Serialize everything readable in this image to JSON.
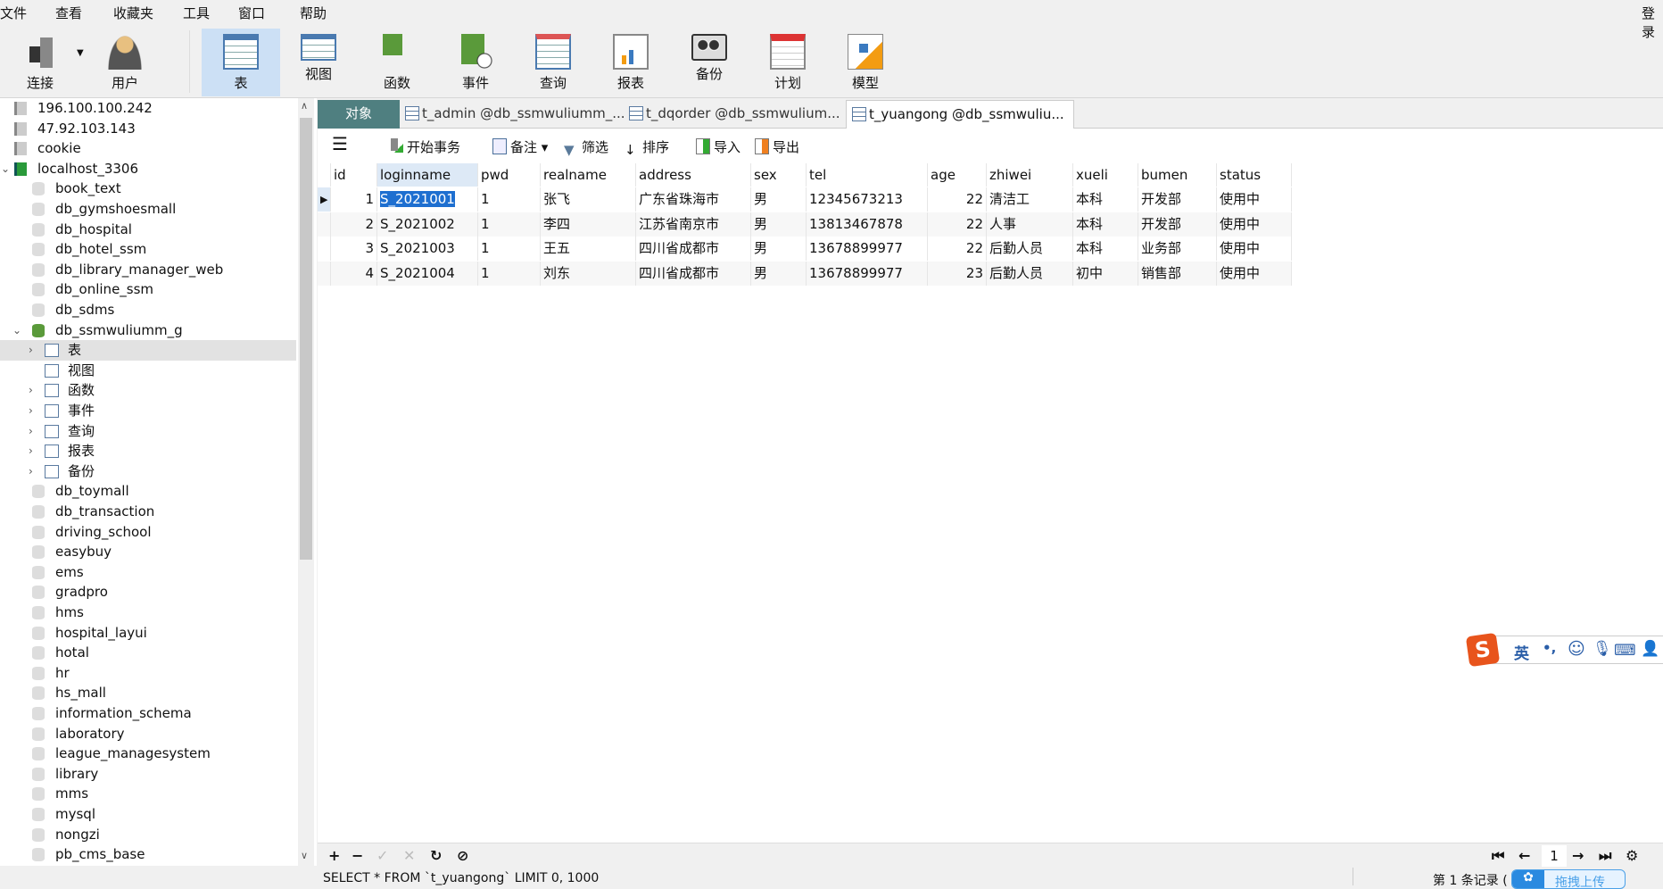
{
  "menubar": {
    "items": [
      "文件",
      "查看",
      "收藏夹",
      "工具",
      "窗口",
      "帮助"
    ],
    "login": "登录"
  },
  "toolbar": {
    "buttons": [
      {
        "label": "连接",
        "icon": "plug-server-icon"
      },
      {
        "label": "用户",
        "icon": "user-icon"
      },
      {
        "label": "表",
        "icon": "table-icon",
        "active": true
      },
      {
        "label": "视图",
        "icon": "view-glasses-icon"
      },
      {
        "label": "函数",
        "icon": "function-icon"
      },
      {
        "label": "事件",
        "icon": "event-clock-icon"
      },
      {
        "label": "查询",
        "icon": "query-icon"
      },
      {
        "label": "报表",
        "icon": "report-icon"
      },
      {
        "label": "备份",
        "icon": "backup-icon"
      },
      {
        "label": "计划",
        "icon": "schedule-calendar-icon"
      },
      {
        "label": "模型",
        "icon": "model-icon"
      }
    ]
  },
  "sidebar": {
    "items": [
      {
        "label": "196.100.100.242",
        "level": 0,
        "type": "conn-off"
      },
      {
        "label": "47.92.103.143",
        "level": 0,
        "type": "conn-off"
      },
      {
        "label": "cookie",
        "level": 0,
        "type": "conn-off"
      },
      {
        "label": "localhost_3306",
        "level": 0,
        "type": "conn-on",
        "expanded": true
      },
      {
        "label": "book_text",
        "level": 1,
        "type": "db"
      },
      {
        "label": "db_gymshoesmall",
        "level": 1,
        "type": "db"
      },
      {
        "label": "db_hospital",
        "level": 1,
        "type": "db"
      },
      {
        "label": "db_hotel_ssm",
        "level": 1,
        "type": "db"
      },
      {
        "label": "db_library_manager_web",
        "level": 1,
        "type": "db"
      },
      {
        "label": "db_online_ssm",
        "level": 1,
        "type": "db"
      },
      {
        "label": "db_sdms",
        "level": 1,
        "type": "db"
      },
      {
        "label": "db_ssmwuliumm_g",
        "level": 1,
        "type": "db-open",
        "expanded": true
      },
      {
        "label": "表",
        "level": 2,
        "type": "tables",
        "selected": true,
        "arrow": true
      },
      {
        "label": "视图",
        "level": 2,
        "type": "views"
      },
      {
        "label": "函数",
        "level": 2,
        "type": "functions",
        "arrow": true
      },
      {
        "label": "事件",
        "level": 2,
        "type": "events",
        "arrow": true
      },
      {
        "label": "查询",
        "level": 2,
        "type": "queries",
        "arrow": true
      },
      {
        "label": "报表",
        "level": 2,
        "type": "reports",
        "arrow": true
      },
      {
        "label": "备份",
        "level": 2,
        "type": "backups",
        "arrow": true
      },
      {
        "label": "db_toymall",
        "level": 1,
        "type": "db"
      },
      {
        "label": "db_transaction",
        "level": 1,
        "type": "db"
      },
      {
        "label": "driving_school",
        "level": 1,
        "type": "db"
      },
      {
        "label": "easybuy",
        "level": 1,
        "type": "db"
      },
      {
        "label": "ems",
        "level": 1,
        "type": "db"
      },
      {
        "label": "gradpro",
        "level": 1,
        "type": "db"
      },
      {
        "label": "hms",
        "level": 1,
        "type": "db"
      },
      {
        "label": "hospital_layui",
        "level": 1,
        "type": "db"
      },
      {
        "label": "hotal",
        "level": 1,
        "type": "db"
      },
      {
        "label": "hr",
        "level": 1,
        "type": "db"
      },
      {
        "label": "hs_mall",
        "level": 1,
        "type": "db"
      },
      {
        "label": "information_schema",
        "level": 1,
        "type": "db"
      },
      {
        "label": "laboratory",
        "level": 1,
        "type": "db"
      },
      {
        "label": "league_managesystem",
        "level": 1,
        "type": "db"
      },
      {
        "label": "library",
        "level": 1,
        "type": "db"
      },
      {
        "label": "mms",
        "level": 1,
        "type": "db"
      },
      {
        "label": "mysql",
        "level": 1,
        "type": "db"
      },
      {
        "label": "nongzi",
        "level": 1,
        "type": "db"
      },
      {
        "label": "pb_cms_base",
        "level": 1,
        "type": "db"
      }
    ]
  },
  "tabs": [
    {
      "label": "对象",
      "kind": "obj"
    },
    {
      "label": "t_admin @db_ssmwuliumm_...",
      "kind": "table"
    },
    {
      "label": "t_dqorder @db_ssmwulium...",
      "kind": "table"
    },
    {
      "label": "t_yuangong @db_ssmwuliu...",
      "kind": "table",
      "active": true
    }
  ],
  "gridbar": {
    "begin_tx": "开始事务",
    "note": "备注",
    "filter": "筛选",
    "sort": "排序",
    "import": "导入",
    "export": "导出"
  },
  "grid": {
    "columns": [
      "id",
      "loginname",
      "pwd",
      "realname",
      "address",
      "sex",
      "tel",
      "age",
      "zhiwei",
      "xueli",
      "bumen",
      "status"
    ],
    "rows": [
      [
        "1",
        "S_2021001",
        "1",
        "张飞",
        "广东省珠海市",
        "男",
        "12345673213",
        "22",
        "清洁工",
        "本科",
        "开发部",
        "使用中"
      ],
      [
        "2",
        "S_2021002",
        "1",
        "李四",
        "江苏省南京市",
        "男",
        "13813467878",
        "22",
        "人事",
        "本科",
        "开发部",
        "使用中"
      ],
      [
        "3",
        "S_2021003",
        "1",
        "王五",
        "四川省成都市",
        "男",
        "13678899977",
        "22",
        "后勤人员",
        "本科",
        "业务部",
        "使用中"
      ],
      [
        "4",
        "S_2021004",
        "1",
        "刘东",
        "四川省成都市",
        "男",
        "13678899977",
        "23",
        "后勤人员",
        "初中",
        "销售部",
        "使用中"
      ]
    ],
    "selected_cell": "S_2021001"
  },
  "bottombar": {
    "page": "1"
  },
  "statusbar": {
    "sql": "SELECT * FROM `t_yuangong` LIMIT 0, 1000",
    "record": "第 1 条记录 (",
    "upload": "拖拽上传"
  },
  "ime": {
    "mode": "英",
    "punct": "•,"
  }
}
